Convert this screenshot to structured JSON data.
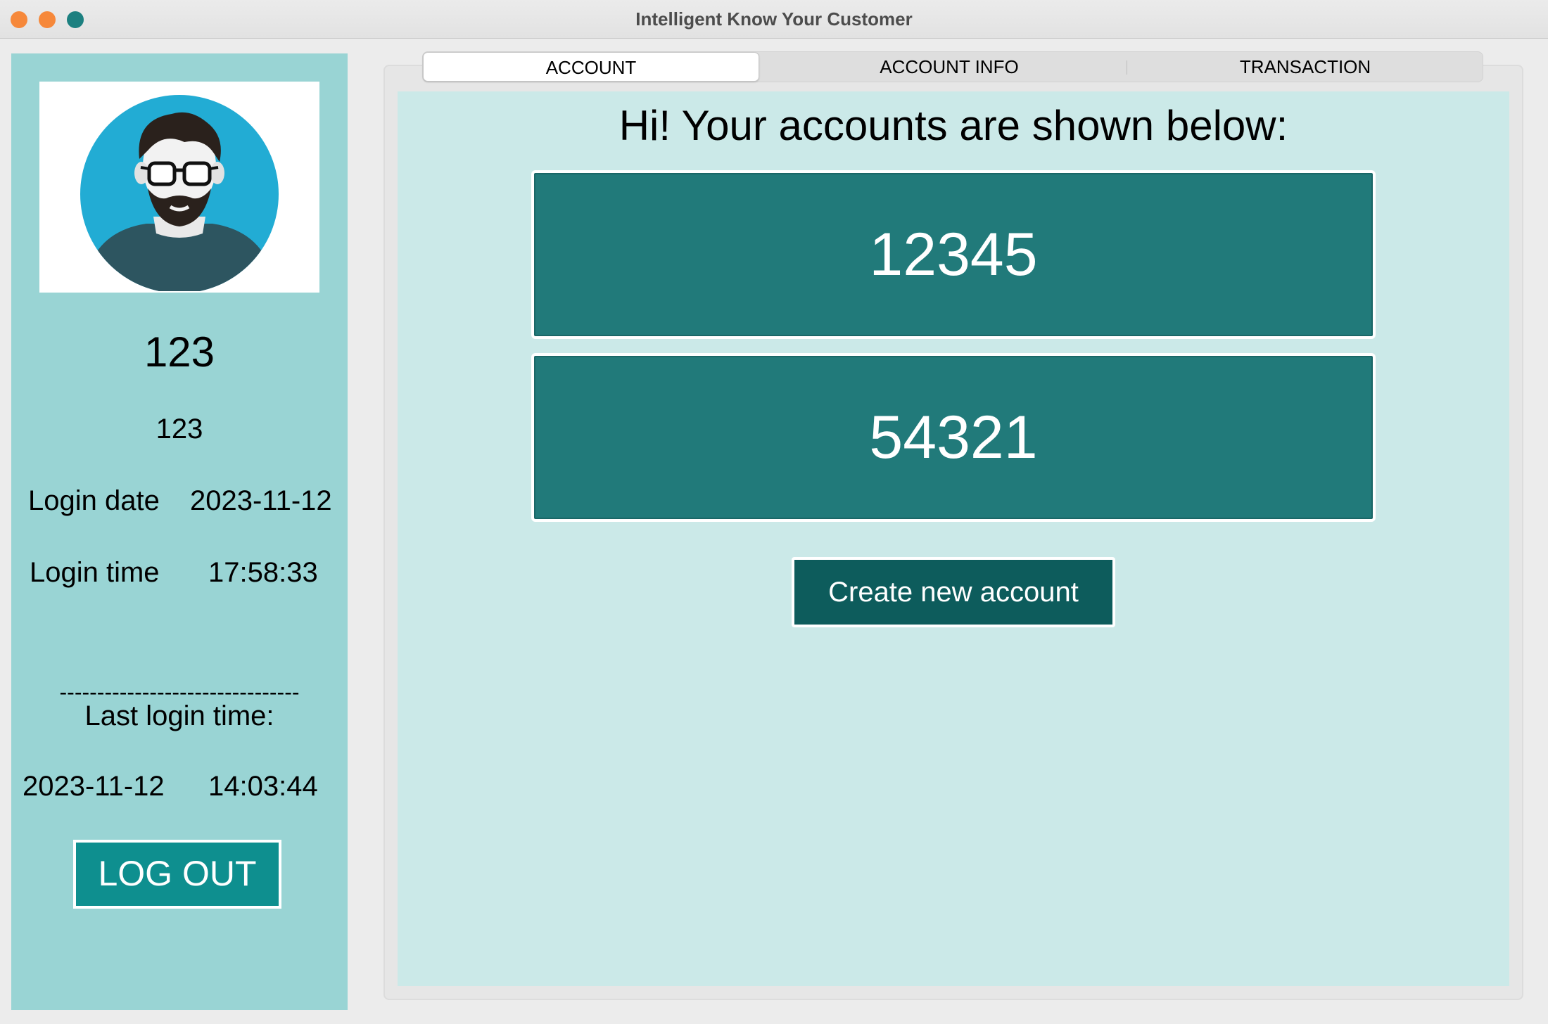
{
  "window": {
    "title": "Intelligent Know Your Customer",
    "controls": {
      "close_color": "#f6883a",
      "minimize_color": "#f6883a",
      "maximize_color": "#1c8080"
    }
  },
  "sidebar": {
    "avatar_icon": "user-avatar-icon",
    "user_name": "123",
    "user_id": "123",
    "login_date_label": "Login date",
    "login_date_value": "2023-11-12",
    "login_time_label": "Login time",
    "login_time_value": "17:58:33",
    "divider": "--------------------------------",
    "last_login_label": "Last login time:",
    "last_login_date": "2023-11-12",
    "last_login_time": "14:03:44",
    "logout_label": "LOG OUT"
  },
  "tabs": [
    {
      "label": "ACCOUNT",
      "active": true
    },
    {
      "label": "ACCOUNT INFO",
      "active": false
    },
    {
      "label": "TRANSACTION",
      "active": false
    }
  ],
  "main": {
    "greeting": "Hi! Your accounts are shown below:",
    "accounts": [
      "12345",
      "54321"
    ],
    "create_button_label": "Create new account"
  },
  "colors": {
    "sidebar_bg": "#99d4d4",
    "content_bg": "#cbe9e8",
    "account_card": "#217a7a",
    "create_button": "#0d5c5c",
    "logout_button": "#0e8f8f"
  }
}
